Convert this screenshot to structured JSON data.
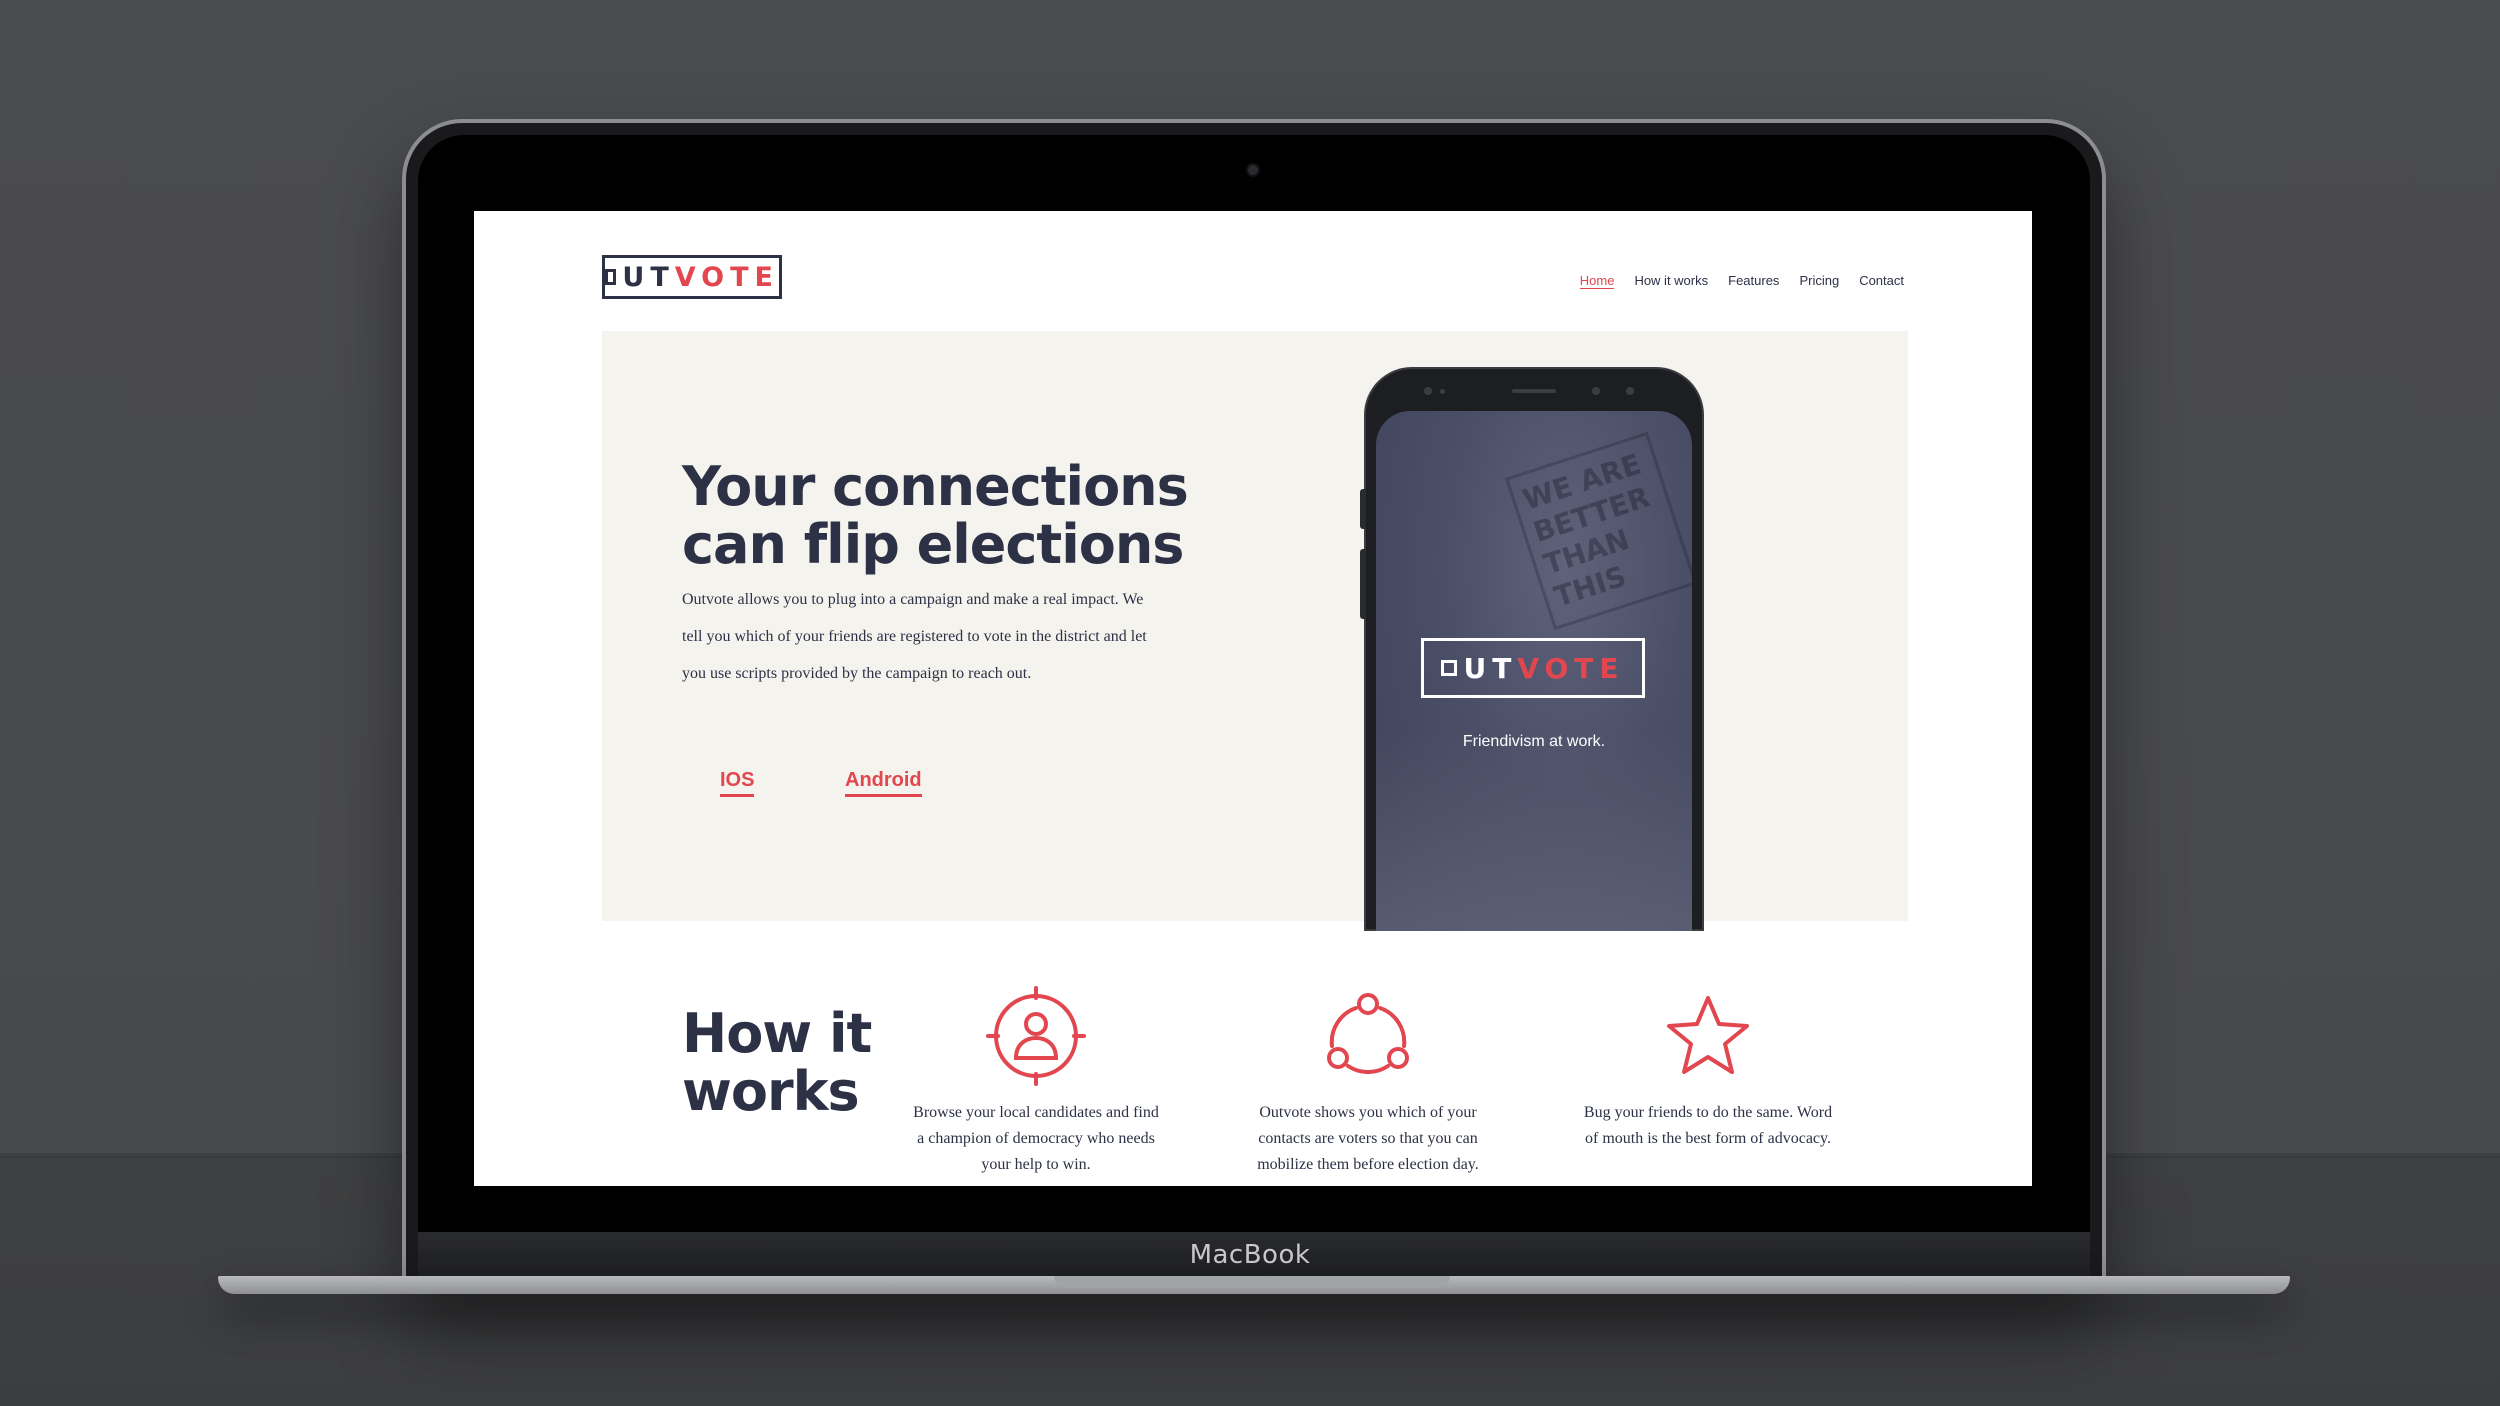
{
  "device": {
    "label": "MacBook"
  },
  "site": {
    "logo": {
      "text_dark": "UT",
      "text_accent": "VOTE",
      "mark": "O"
    },
    "nav": [
      {
        "label": "Home",
        "active": true
      },
      {
        "label": "How it works",
        "active": false
      },
      {
        "label": "Features",
        "active": false
      },
      {
        "label": "Pricing",
        "active": false
      },
      {
        "label": "Contact",
        "active": false
      }
    ],
    "hero": {
      "title": "Your connections can flip elections",
      "body": "Outvote allows you to plug into a campaign and make a real impact. We tell you which of your friends are registered to vote in the district and let you use scripts provided by the campaign to reach out.",
      "ios_label": "IOS",
      "android_label": "Android"
    },
    "phone": {
      "tagline": "Friendivism at work.",
      "sign_text": "WE ARE BETTER THAN THIS"
    },
    "how_it_works": {
      "title": "How it works",
      "features": [
        {
          "icon": "person-target-icon",
          "text": "Browse your local candidates and find a champion of democracy who needs your help to win."
        },
        {
          "icon": "network-icon",
          "text": "Outvote shows you which of your contacts are voters so that you can mobilize them before election day."
        },
        {
          "icon": "star-icon",
          "text": "Bug your friends to do the same. Word of mouth is the best form of advocacy."
        }
      ]
    },
    "colors": {
      "accent": "#e2474f",
      "navy": "#2c3146",
      "hero_bg": "#f5f3ee"
    }
  }
}
